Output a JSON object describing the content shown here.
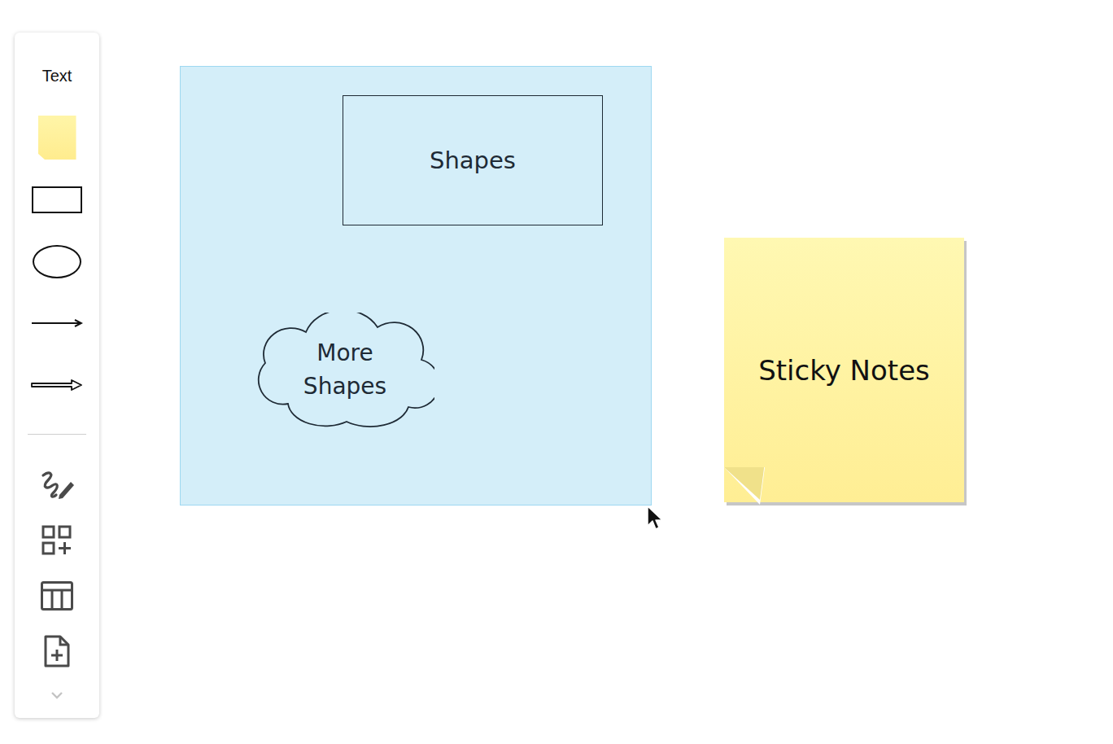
{
  "toolbar": {
    "tools": [
      {
        "kind": "text",
        "label": "Text",
        "selected": false
      },
      {
        "kind": "sticky",
        "selected": false
      },
      {
        "kind": "rectangle",
        "selected": false
      },
      {
        "kind": "ellipse",
        "selected": false
      },
      {
        "kind": "line",
        "selected": false
      },
      {
        "kind": "arrow",
        "selected": false
      }
    ],
    "insert": [
      {
        "kind": "pen",
        "selected": false
      },
      {
        "kind": "shapes",
        "selected": false
      },
      {
        "kind": "table",
        "selected": false
      },
      {
        "kind": "document",
        "selected": false
      }
    ]
  },
  "canvas": {
    "frame": {
      "selected": false
    },
    "shapes": [
      {
        "kind": "rectangle",
        "label": "Shapes"
      },
      {
        "kind": "cloud",
        "label": "More Shapes"
      }
    ],
    "sticky_note": {
      "label": "Sticky Notes"
    }
  }
}
